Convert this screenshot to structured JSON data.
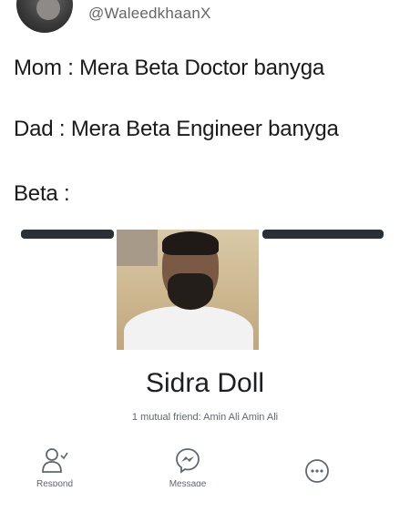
{
  "header": {
    "handle": "@WaleedkhaanX",
    "avatar_icon": "user-avatar"
  },
  "tweet": {
    "lines": [
      "Mom : Mera Beta Doctor banyga",
      "Dad : Mera Beta Engineer banyga",
      "Beta :"
    ]
  },
  "profile": {
    "name": "Sidra Doll",
    "mutual": "1 mutual friend: Amin Ali Amin Ali",
    "cover_color": "#2b2f36"
  },
  "actions": [
    {
      "label": "Respond",
      "icon": "add-friend-icon"
    },
    {
      "label": "Message",
      "icon": "messenger-icon"
    },
    {
      "label": "",
      "icon": "more-options-icon"
    }
  ]
}
